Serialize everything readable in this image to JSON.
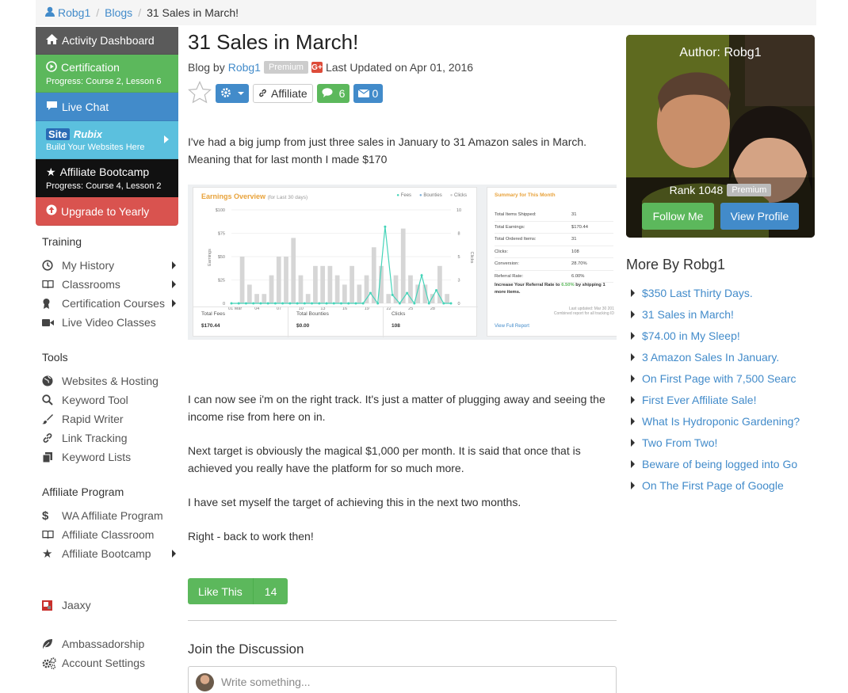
{
  "breadcrumb": {
    "user": "Robg1",
    "blogs": "Blogs",
    "current": "31 Sales in March!"
  },
  "sidebar": {
    "dashboard": "Activity Dashboard",
    "certification": {
      "title": "Certification",
      "sub": "Progress: Course 2, Lesson 6"
    },
    "live_chat": "Live Chat",
    "siterubix": {
      "logo_a": "Site",
      "logo_b": "Rubix",
      "sub": "Build Your Websites Here"
    },
    "bootcamp": {
      "title": "Affiliate Bootcamp",
      "sub": "Progress: Course 4, Lesson 2"
    },
    "upgrade": "Upgrade to Yearly",
    "training_title": "Training",
    "training": [
      "My History",
      "Classrooms",
      "Certification Courses",
      "Live Video Classes"
    ],
    "tools_title": "Tools",
    "tools": [
      "Websites & Hosting",
      "Keyword Tool",
      "Rapid Writer",
      "Link Tracking",
      "Keyword Lists"
    ],
    "affiliate_title": "Affiliate Program",
    "affiliate": [
      "WA Affiliate Program",
      "Affiliate Classroom",
      "Affiliate Bootcamp"
    ],
    "jaaxy": "Jaaxy",
    "ambassadorship": "Ambassadorship",
    "account": "Account Settings"
  },
  "post": {
    "title": "31 Sales in March!",
    "by": "Blog by",
    "author": "Robg1",
    "badge": "Premium",
    "gplus": "G+",
    "updated": "Last Updated on Apr 01, 2016",
    "affiliate": "Affiliate",
    "comments": "6",
    "messages": "0",
    "p1": "I've had a big jump from just three sales in January to 31 Amazon sales in March. Meaning that for last month I made $170",
    "p2": "I can now see i'm on the right track. It's just a matter of plugging away and seeing the income rise from here on in.",
    "p3": "Next target is obviously the magical $1,000 per month. It is said that once that is achieved you really have the platform for so much more.",
    "p4": "I have set myself the target of achieving this in the next two months.",
    "p5": "Right - back to work then!",
    "like": "Like This",
    "like_count": "14",
    "join": "Join the Discussion",
    "write_placeholder": "Write something..."
  },
  "earnings": {
    "title": "Earnings Overview",
    "period": "(for Last 30 days)",
    "legend": [
      "Fees",
      "Bounties",
      "Clicks"
    ],
    "y_left": [
      "$100",
      "$75",
      "$50",
      "$25",
      "0"
    ],
    "y_right": [
      "10",
      "8",
      "5",
      "3",
      "0"
    ],
    "ylabel_left": "Earnings",
    "ylabel_right": "Clicks",
    "x_ticks": [
      "01 Mar",
      "04",
      "07",
      "10",
      "13",
      "16",
      "19",
      "22",
      "25",
      "28"
    ],
    "totals": [
      {
        "label": "Total Fees",
        "value": "$170.44"
      },
      {
        "label": "Total Bounties",
        "value": "$0.00"
      },
      {
        "label": "Clicks",
        "value": "108"
      }
    ],
    "summary_title": "Summary for This Month",
    "summary": [
      {
        "k": "Total Items Shipped:",
        "v": "31"
      },
      {
        "k": "Total Earnings:",
        "v": "$170.44"
      },
      {
        "k": "Total Ordered Items:",
        "v": "31"
      },
      {
        "k": "Clicks:",
        "v": "108"
      },
      {
        "k": "Conversion:",
        "v": "28.70%"
      },
      {
        "k": "Referral Rate:",
        "v": "6.00%"
      }
    ],
    "increase_a": "Increase Your Referral Rate to",
    "increase_rate": "6.50%",
    "increase_b": "by",
    "increase_c": "shipping",
    "increase_n": "1",
    "increase_d": "more items.",
    "last_updated": "Last updated: Mar 30 201",
    "combined": "Combined report for all tracking ID",
    "view_full": "View Full Report",
    "clicks": [
      0,
      5,
      2,
      1,
      1,
      3,
      5,
      5,
      7,
      3,
      1,
      4,
      4,
      4,
      3,
      2,
      4,
      2,
      3,
      6,
      4,
      1,
      3,
      8,
      3,
      2,
      2,
      1,
      4,
      1
    ],
    "fees": [
      0,
      0,
      0,
      0,
      0,
      0,
      0,
      0,
      0,
      0,
      0,
      0,
      0,
      0,
      0,
      0,
      0,
      0,
      0,
      11,
      0,
      82,
      9,
      0,
      11,
      0,
      30,
      0,
      14,
      0,
      0
    ]
  },
  "author": {
    "title": "Author: Robg1",
    "rank": "Rank 1048",
    "badge": "Premium",
    "follow": "Follow Me",
    "view": "View Profile"
  },
  "more": {
    "title": "More By Robg1",
    "items": [
      "$350 Last Thirty Days.",
      "31 Sales in March!",
      "$74.00 in My Sleep!",
      "3 Amazon Sales In January.",
      "On First Page with 7,500 Searc",
      "First Ever Affiliate Sale!",
      "What Is Hydroponic Gardening?",
      "Two From Two!",
      "Beware of being logged into Go",
      "On The First Page of Google"
    ]
  },
  "colors": {
    "link": "#428bca",
    "green": "#5cb85c",
    "red": "#d9534f",
    "info": "#5bc0de",
    "orange": "#f0ad4e",
    "teal": "#45d4b9"
  }
}
